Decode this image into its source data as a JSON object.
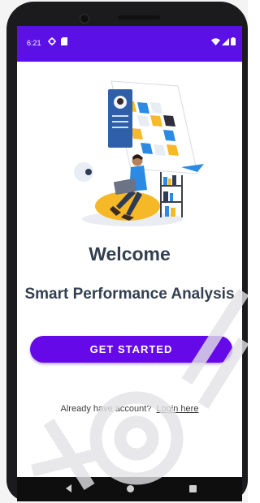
{
  "status_bar": {
    "time": "6:21",
    "icons": [
      "gear-icon",
      "sd-card-icon",
      "wifi-icon",
      "signal-icon",
      "battery-icon"
    ],
    "background_color": "#5b10e6"
  },
  "main": {
    "illustration": "person-with-laptop-calendar-illustration",
    "welcome_heading": "Welcome",
    "subtitle": "Smart Performance Analysis",
    "get_started_label": "GET STARTED",
    "have_account_text": "Already have account?",
    "login_link_label": "Login here",
    "accent_color": "#6509e8"
  },
  "nav_bar": {
    "buttons": [
      "back-icon",
      "home-icon",
      "recents-icon"
    ]
  }
}
